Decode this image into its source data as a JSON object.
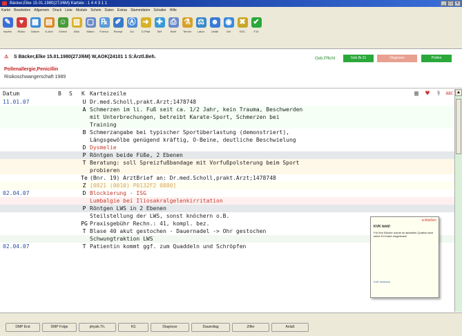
{
  "window": {
    "title": "Bäcker,Elke 15.01.1980(27J/6M) Karteie : 1 4 4 3 1 1"
  },
  "menubar": [
    "Kartei",
    "Bearbeiten",
    "Allgemein",
    "Druck",
    "Liste",
    "Module",
    "Schein",
    "Daten",
    "Extras",
    "Stammdaten",
    "Schalter",
    "Hilfe"
  ],
  "toolbar": [
    {
      "icon": "pen-icon",
      "label": "Impfen",
      "color": "#3a6fd8"
    },
    {
      "icon": "heart-icon",
      "label": "Risiko",
      "color": "#d23a3a"
    },
    {
      "icon": "calendar-icon",
      "label": "Datum",
      "color": "#3a8ad8"
    },
    {
      "icon": "form-icon",
      "label": "D-Arzt",
      "color": "#d88a2a"
    },
    {
      "icon": "person-icon",
      "label": "IVmbd",
      "color": "#4a9a3a"
    },
    {
      "icon": "chart-icon",
      "label": "AMu",
      "color": "#d8b02a"
    },
    {
      "icon": "document-icon",
      "label": "Makro",
      "color": "#6a8ac8"
    },
    {
      "icon": "rezept-icon",
      "label": "Formul.",
      "color": "#5a9ad8"
    },
    {
      "icon": "pen2-icon",
      "label": "Rezept",
      "color": "#3a7ac8"
    },
    {
      "icon": "au-icon",
      "label": "AU",
      "color": "#4a8ad8"
    },
    {
      "icon": "overweisung-icon",
      "label": "Ü-Pfad",
      "color": "#d8b02a"
    },
    {
      "icon": "befund-icon",
      "label": "Bef",
      "color": "#3a9ad8"
    },
    {
      "icon": "print-icon",
      "label": "Brief",
      "color": "#6a8ac8"
    },
    {
      "icon": "labor-icon",
      "label": "Termin",
      "color": "#d8a02a"
    },
    {
      "icon": "labor2-icon",
      "label": "Labor",
      "color": "#3a8ac8"
    },
    {
      "icon": "user-icon",
      "label": "Unfall",
      "color": "#3a7ad8"
    },
    {
      "icon": "db-icon",
      "label": "Del",
      "color": "#3a8ad8"
    },
    {
      "icon": "esc-icon",
      "label": "ESC",
      "color": "#c8a82a"
    },
    {
      "icon": "check-icon",
      "label": "F10",
      "color": "#2aa83a"
    }
  ],
  "patient": {
    "headline": "S Bäcker,Elke 15.01.1980(27J/6M) W,AOK(24101 1 S:Ärztl.Beh.",
    "allergy": "Pollenallergie,Penicillin",
    "risk": "Risikoschwangerschaft 1989",
    "gebpflicht": "Geb.Pflicht",
    "badges": [
      {
        "label": "Geb.Br.21",
        "color": "#2aa83a"
      },
      {
        "label": "Diagnose",
        "color": "#e8a090"
      },
      {
        "label": "Prüfen",
        "color": "#2aa83a"
      }
    ]
  },
  "table": {
    "headers": {
      "datum": "Datum",
      "b": "B",
      "s": "S",
      "k": "K",
      "text": "Karteizeile"
    },
    "rows": [
      {
        "date": "11.01.07",
        "k": "U",
        "text": "Dr.med.Scholl,prakt.Arzt;1478748",
        "color": "#222",
        "bg": "#ffffff"
      },
      {
        "date": "",
        "k": "A",
        "text": "Schmerzen im li. Fuß seit ca. 1/2 Jahr, kein Trauma, Beschwerden",
        "color": "#222",
        "bg": "#f5fff5"
      },
      {
        "date": "",
        "k": "",
        "text": "mit Unterbrechungen, betreibt Karate-Sport, Schmerzen bei",
        "color": "#222",
        "bg": "#f5fff5"
      },
      {
        "date": "",
        "k": "",
        "text": "Training",
        "color": "#222",
        "bg": "#f5fff5"
      },
      {
        "date": "",
        "k": "B",
        "text": "Schmerzangabe bei typischer Sportüberlastung (demonstriert),",
        "color": "#222",
        "bg": "#ffffff"
      },
      {
        "date": "",
        "k": "",
        "text": "Längsgewölbe genügend kräftig, O-Beine, deutliche Beschwielung",
        "color": "#222",
        "bg": "#ffffff"
      },
      {
        "date": "",
        "k": "D",
        "text": "Dysmelie",
        "color": "#c23a2a",
        "bg": "#ffffff"
      },
      {
        "date": "",
        "k": "P",
        "text": "Röntgen beide Füße, 2 Ebenen",
        "color": "#222",
        "bg": "#e4e8ea"
      },
      {
        "date": "",
        "k": "T",
        "text": "Beratung: soll Spreizfußbandage mit Vorfußpolsterung beim Sport",
        "color": "#222",
        "bg": "#fff8e8"
      },
      {
        "date": "",
        "k": "",
        "text": "probieren",
        "color": "#222",
        "bg": "#fff8e8"
      },
      {
        "date": "",
        "k": "Te",
        "text": "(Bnr. 19) ArztBrief an: Dr.med.Scholl,prakt.Arzt;1478748",
        "color": "#222",
        "bg": "#ffffff"
      },
      {
        "date": "",
        "k": "Z",
        "text": "[0821 (0010) P0132F2 0880]",
        "color": "#d8a05a",
        "bg": "#fffff0"
      },
      {
        "date": "02.04.07",
        "k": "D",
        "text": "Blockierung - ISG",
        "color": "#c23a2a",
        "bg": "#ffffff"
      },
      {
        "date": "",
        "k": "",
        "text": "Lumbalgie bei Iliosakralgelenkirritation",
        "color": "#c23a2a",
        "bg": "#fff0f0"
      },
      {
        "date": "",
        "k": "P",
        "text": "Röntgen LWS in 2 Ebenen",
        "color": "#222",
        "bg": "#e4e8ea"
      },
      {
        "date": "",
        "k": "",
        "text": "Steilstellung der LWS, sonst knöchern o.B.",
        "color": "#222",
        "bg": "#ffffff"
      },
      {
        "date": "",
        "k": "PG",
        "text": "Praxisgebühr Rechn.:      41, kompl. bez.",
        "color": "#222",
        "bg": "#ffffff"
      },
      {
        "date": "",
        "k": "T",
        "text": "Blase 40 akut gestochen - Dauernadel -> Ohr gestochen",
        "color": "#222",
        "bg": "#ffffff"
      },
      {
        "date": "",
        "k": "",
        "text": "Schwungtraktion LWS",
        "color": "#222",
        "bg": "#f0f8f0"
      },
      {
        "date": "02.04.07",
        "k": "T",
        "text": "Patientin kommt ggf. zum Quaddeln und Schröpfen",
        "color": "#222",
        "bg": "#ffffff"
      }
    ]
  },
  "popup": {
    "close_label": "schließen",
    "title": "KVK fehlt!",
    "body": "Für Ihre Bücher wurde im aktuellen Quartal noch keine KV-Karte eingelesen!",
    "footer": "KVK einlesen"
  },
  "bottom_buttons": [
    "DMP Erst",
    "DMP Folge",
    "physik.Th.",
    "KS",
    "Diagnose",
    "Dauerdiag",
    "Ziffer",
    "Anlaß"
  ]
}
